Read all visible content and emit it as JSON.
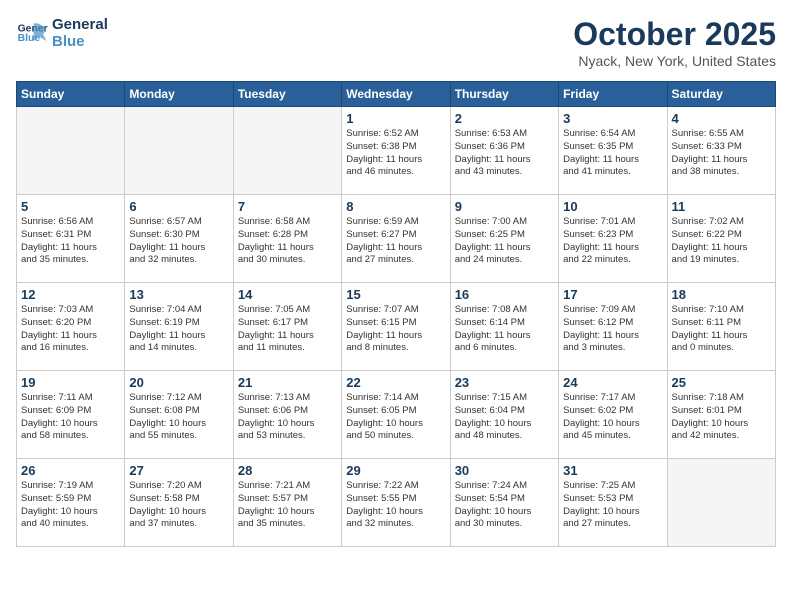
{
  "header": {
    "logo_line1": "General",
    "logo_line2": "Blue",
    "month": "October 2025",
    "location": "Nyack, New York, United States"
  },
  "weekdays": [
    "Sunday",
    "Monday",
    "Tuesday",
    "Wednesday",
    "Thursday",
    "Friday",
    "Saturday"
  ],
  "weeks": [
    [
      {
        "day": "",
        "text": ""
      },
      {
        "day": "",
        "text": ""
      },
      {
        "day": "",
        "text": ""
      },
      {
        "day": "1",
        "text": "Sunrise: 6:52 AM\nSunset: 6:38 PM\nDaylight: 11 hours\nand 46 minutes."
      },
      {
        "day": "2",
        "text": "Sunrise: 6:53 AM\nSunset: 6:36 PM\nDaylight: 11 hours\nand 43 minutes."
      },
      {
        "day": "3",
        "text": "Sunrise: 6:54 AM\nSunset: 6:35 PM\nDaylight: 11 hours\nand 41 minutes."
      },
      {
        "day": "4",
        "text": "Sunrise: 6:55 AM\nSunset: 6:33 PM\nDaylight: 11 hours\nand 38 minutes."
      }
    ],
    [
      {
        "day": "5",
        "text": "Sunrise: 6:56 AM\nSunset: 6:31 PM\nDaylight: 11 hours\nand 35 minutes."
      },
      {
        "day": "6",
        "text": "Sunrise: 6:57 AM\nSunset: 6:30 PM\nDaylight: 11 hours\nand 32 minutes."
      },
      {
        "day": "7",
        "text": "Sunrise: 6:58 AM\nSunset: 6:28 PM\nDaylight: 11 hours\nand 30 minutes."
      },
      {
        "day": "8",
        "text": "Sunrise: 6:59 AM\nSunset: 6:27 PM\nDaylight: 11 hours\nand 27 minutes."
      },
      {
        "day": "9",
        "text": "Sunrise: 7:00 AM\nSunset: 6:25 PM\nDaylight: 11 hours\nand 24 minutes."
      },
      {
        "day": "10",
        "text": "Sunrise: 7:01 AM\nSunset: 6:23 PM\nDaylight: 11 hours\nand 22 minutes."
      },
      {
        "day": "11",
        "text": "Sunrise: 7:02 AM\nSunset: 6:22 PM\nDaylight: 11 hours\nand 19 minutes."
      }
    ],
    [
      {
        "day": "12",
        "text": "Sunrise: 7:03 AM\nSunset: 6:20 PM\nDaylight: 11 hours\nand 16 minutes."
      },
      {
        "day": "13",
        "text": "Sunrise: 7:04 AM\nSunset: 6:19 PM\nDaylight: 11 hours\nand 14 minutes."
      },
      {
        "day": "14",
        "text": "Sunrise: 7:05 AM\nSunset: 6:17 PM\nDaylight: 11 hours\nand 11 minutes."
      },
      {
        "day": "15",
        "text": "Sunrise: 7:07 AM\nSunset: 6:15 PM\nDaylight: 11 hours\nand 8 minutes."
      },
      {
        "day": "16",
        "text": "Sunrise: 7:08 AM\nSunset: 6:14 PM\nDaylight: 11 hours\nand 6 minutes."
      },
      {
        "day": "17",
        "text": "Sunrise: 7:09 AM\nSunset: 6:12 PM\nDaylight: 11 hours\nand 3 minutes."
      },
      {
        "day": "18",
        "text": "Sunrise: 7:10 AM\nSunset: 6:11 PM\nDaylight: 11 hours\nand 0 minutes."
      }
    ],
    [
      {
        "day": "19",
        "text": "Sunrise: 7:11 AM\nSunset: 6:09 PM\nDaylight: 10 hours\nand 58 minutes."
      },
      {
        "day": "20",
        "text": "Sunrise: 7:12 AM\nSunset: 6:08 PM\nDaylight: 10 hours\nand 55 minutes."
      },
      {
        "day": "21",
        "text": "Sunrise: 7:13 AM\nSunset: 6:06 PM\nDaylight: 10 hours\nand 53 minutes."
      },
      {
        "day": "22",
        "text": "Sunrise: 7:14 AM\nSunset: 6:05 PM\nDaylight: 10 hours\nand 50 minutes."
      },
      {
        "day": "23",
        "text": "Sunrise: 7:15 AM\nSunset: 6:04 PM\nDaylight: 10 hours\nand 48 minutes."
      },
      {
        "day": "24",
        "text": "Sunrise: 7:17 AM\nSunset: 6:02 PM\nDaylight: 10 hours\nand 45 minutes."
      },
      {
        "day": "25",
        "text": "Sunrise: 7:18 AM\nSunset: 6:01 PM\nDaylight: 10 hours\nand 42 minutes."
      }
    ],
    [
      {
        "day": "26",
        "text": "Sunrise: 7:19 AM\nSunset: 5:59 PM\nDaylight: 10 hours\nand 40 minutes."
      },
      {
        "day": "27",
        "text": "Sunrise: 7:20 AM\nSunset: 5:58 PM\nDaylight: 10 hours\nand 37 minutes."
      },
      {
        "day": "28",
        "text": "Sunrise: 7:21 AM\nSunset: 5:57 PM\nDaylight: 10 hours\nand 35 minutes."
      },
      {
        "day": "29",
        "text": "Sunrise: 7:22 AM\nSunset: 5:55 PM\nDaylight: 10 hours\nand 32 minutes."
      },
      {
        "day": "30",
        "text": "Sunrise: 7:24 AM\nSunset: 5:54 PM\nDaylight: 10 hours\nand 30 minutes."
      },
      {
        "day": "31",
        "text": "Sunrise: 7:25 AM\nSunset: 5:53 PM\nDaylight: 10 hours\nand 27 minutes."
      },
      {
        "day": "",
        "text": ""
      }
    ]
  ]
}
